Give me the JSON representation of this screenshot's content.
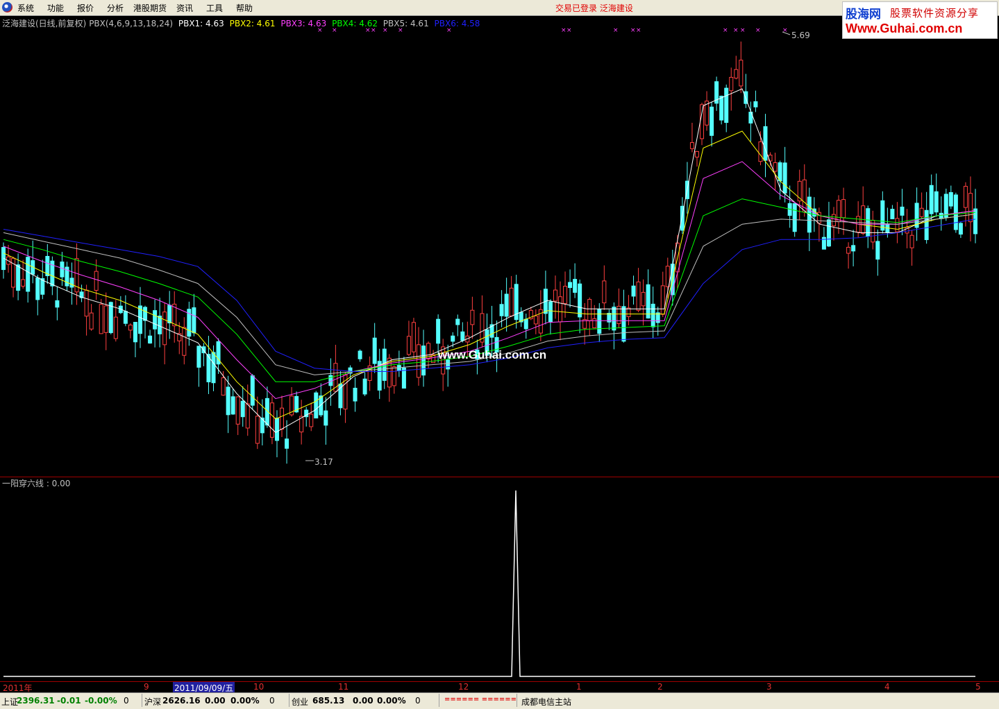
{
  "menu": {
    "items": [
      "系统",
      "功能",
      "报价",
      "分析",
      "港股期货",
      "资讯",
      "工具",
      "帮助"
    ],
    "status": "交易已登录  泛海建设"
  },
  "logo": {
    "line1a": "股海网",
    "line1b": "股票软件资源分享",
    "line2": "Www.Guhai.com.cn"
  },
  "main_chart": {
    "title": "泛海建设(日线,前复权)",
    "indicator": "PBX(4,6,9,13,18,24)",
    "values": [
      {
        "label": "PBX1: 4.63",
        "color": "#ffffff"
      },
      {
        "label": "PBX2: 4.61",
        "color": "#ffff00"
      },
      {
        "label": "PBX3: 4.63",
        "color": "#ff40ff"
      },
      {
        "label": "PBX4: 4.62",
        "color": "#00ff00"
      },
      {
        "label": "PBX5: 4.61",
        "color": "#c0c0c0"
      },
      {
        "label": "PBX6: 4.58",
        "color": "#2020ff"
      }
    ],
    "high_label": "5.69",
    "low_label": "3.17",
    "watermark": "www.Guhai.com.cn"
  },
  "sub_chart": {
    "label": "一阳穿六线 : 0.00"
  },
  "axis": {
    "labels": [
      "2011年",
      "9",
      "10",
      "11",
      "12",
      "1",
      "2",
      "3",
      "4",
      "5"
    ],
    "cursor_date": "2011/09/09/五"
  },
  "status": {
    "sh": {
      "name": "上证",
      "value": "2396.31",
      "change": "-0.01",
      "pct": "-0.00%",
      "vol": "0"
    },
    "hs": {
      "name": "沪深",
      "value": "2626.16",
      "change": "0.00",
      "pct": "0.00%",
      "vol": "0"
    },
    "cy": {
      "name": "创业",
      "value": "685.13",
      "change": "0.00",
      "pct": "0.00%",
      "vol": "0"
    },
    "signal": "====== ======",
    "server": "成都电信主站"
  },
  "chart_data": {
    "type": "candlestick",
    "price_axis": {
      "high": 5.69,
      "low": 3.17
    },
    "ma_series": [
      {
        "name": "PBX1",
        "color": "#ffffff",
        "last": 4.63,
        "values": [
          4.35,
          4.22,
          4.12,
          4.05,
          3.95,
          3.85,
          3.55,
          3.32,
          3.45,
          3.65,
          3.75,
          3.78,
          3.88,
          4.0,
          4.1,
          4.05,
          4.05,
          4.05,
          5.25,
          5.35,
          4.75,
          4.55,
          4.5,
          4.5,
          4.6,
          4.63
        ]
      },
      {
        "name": "PBX2",
        "color": "#ffff00",
        "last": 4.61,
        "values": [
          4.38,
          4.27,
          4.17,
          4.1,
          4.0,
          3.9,
          3.62,
          3.4,
          3.5,
          3.66,
          3.74,
          3.77,
          3.84,
          3.95,
          4.04,
          4.02,
          4.02,
          4.02,
          5.0,
          5.1,
          4.8,
          4.6,
          4.55,
          4.52,
          4.58,
          4.61
        ]
      },
      {
        "name": "PBX3",
        "color": "#ff40ff",
        "last": 4.63,
        "values": [
          4.42,
          4.33,
          4.25,
          4.18,
          4.1,
          4.0,
          3.75,
          3.52,
          3.58,
          3.68,
          3.73,
          3.76,
          3.8,
          3.88,
          3.97,
          3.98,
          3.98,
          3.98,
          4.82,
          4.92,
          4.72,
          4.6,
          4.55,
          4.55,
          4.6,
          4.63
        ]
      },
      {
        "name": "PBX4",
        "color": "#00ff00",
        "last": 4.62,
        "values": [
          4.46,
          4.4,
          4.33,
          4.27,
          4.2,
          4.12,
          3.9,
          3.62,
          3.62,
          3.68,
          3.72,
          3.74,
          3.77,
          3.83,
          3.9,
          3.93,
          3.94,
          3.95,
          4.6,
          4.7,
          4.65,
          4.6,
          4.58,
          4.56,
          4.6,
          4.62
        ]
      },
      {
        "name": "PBX5",
        "color": "#c0c0c0",
        "last": 4.61,
        "values": [
          4.5,
          4.45,
          4.4,
          4.35,
          4.28,
          4.2,
          4.0,
          3.72,
          3.66,
          3.68,
          3.7,
          3.72,
          3.74,
          3.79,
          3.86,
          3.89,
          3.91,
          3.92,
          4.42,
          4.55,
          4.58,
          4.57,
          4.56,
          4.55,
          4.58,
          4.61
        ]
      },
      {
        "name": "PBX6",
        "color": "#2020ff",
        "last": 4.58,
        "values": [
          4.52,
          4.48,
          4.44,
          4.4,
          4.36,
          4.3,
          4.1,
          3.8,
          3.7,
          3.68,
          3.68,
          3.7,
          3.72,
          3.76,
          3.82,
          3.85,
          3.87,
          3.88,
          4.2,
          4.4,
          4.46,
          4.46,
          4.47,
          4.5,
          4.54,
          4.58
        ]
      }
    ],
    "signal_series": {
      "name": "一阳穿六线",
      "last": 0.0,
      "spike_at": "2011-12 late",
      "spike_value": 1
    }
  }
}
